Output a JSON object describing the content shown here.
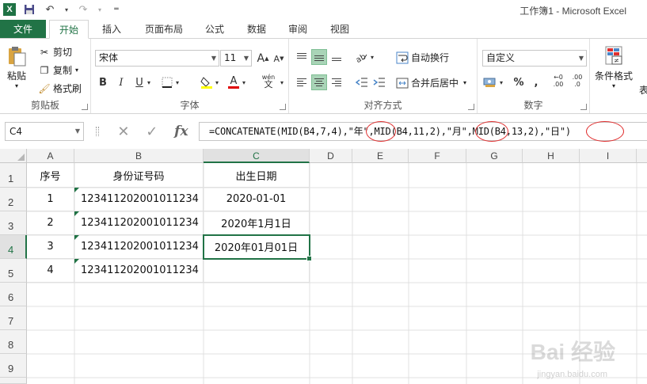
{
  "window": {
    "title": "工作簿1 - Microsoft Excel",
    "app_logo": "X"
  },
  "tabs": [
    "文件",
    "开始",
    "插入",
    "页面布局",
    "公式",
    "数据",
    "审阅",
    "视图"
  ],
  "ribbon": {
    "clipboard": {
      "label": "剪贴板",
      "paste": "粘贴",
      "cut": "剪切",
      "copy": "复制",
      "format_painter": "格式刷"
    },
    "font": {
      "label": "字体",
      "font_name": "宋体",
      "font_size": "11",
      "bold": "B",
      "italic": "I",
      "underline": "U",
      "phonetic": "wén"
    },
    "alignment": {
      "label": "对齐方式",
      "wrap_text": "自动换行",
      "merge_center": "合并后居中"
    },
    "number": {
      "label": "数字",
      "format": "自定义",
      "percent": "%",
      "comma": ",",
      "inc_decimal": ".00",
      "dec_decimal": ".0"
    },
    "styles": {
      "conditional_format": "条件格式",
      "table_partial": "表"
    }
  },
  "formula_bar": {
    "name_box": "C4",
    "fx": "fx",
    "formula": "=CONCATENATE(MID(B4,7,4),\"年\",MID(B4,11,2),\"月\",MID(B4,13,2),\"日\")"
  },
  "sheet": {
    "columns": [
      "A",
      "B",
      "C",
      "D",
      "E",
      "F",
      "G",
      "H",
      "I"
    ],
    "rows": [
      "1",
      "2",
      "3",
      "4",
      "5",
      "6",
      "7",
      "8",
      "9"
    ],
    "headers": [
      "序号",
      "身份证号码",
      "出生日期"
    ],
    "data": [
      [
        "1",
        "123411202001011234",
        "2020-01-01"
      ],
      [
        "2",
        "123411202001011234",
        "2020年1月1日"
      ],
      [
        "3",
        "123411202001011234",
        "2020年01月01日"
      ],
      [
        "4",
        "123411202001011234",
        ""
      ]
    ],
    "active_cell": "C4"
  },
  "watermark": {
    "brand": "Bai 经验",
    "url": "jingyan.baidu.com"
  },
  "colors": {
    "excel_green": "#217346",
    "selection_fill": "#a9d4b7",
    "annotation_red": "#e03030"
  }
}
